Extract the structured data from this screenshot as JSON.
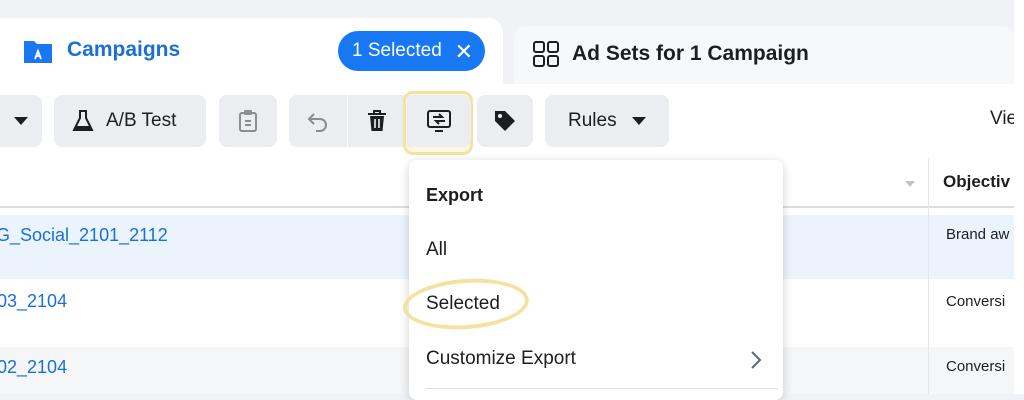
{
  "tabs": {
    "campaigns_label": "Campaigns",
    "selected_label": "1 Selected",
    "selected_close": "✕",
    "adsets_label": "Ad Sets for 1 Campaign"
  },
  "toolbar": {
    "ab_test_label": "A/B Test",
    "rules_label": "Rules",
    "view_partial": "Vie"
  },
  "table": {
    "objective_header": "Objectiv",
    "rows": [
      {
        "name": "G_Social_2101_2112",
        "objective": "Brand aw"
      },
      {
        "name": "03_2104",
        "objective": "Conversi"
      },
      {
        "name": "02_2104",
        "objective": "Conversi"
      }
    ]
  },
  "export_menu": {
    "header": "Export",
    "items": [
      "All",
      "Selected",
      "Customize Export"
    ]
  },
  "colors": {
    "accent": "#1877f2",
    "link": "#1a6fd8",
    "highlight": "#f3e3a0"
  },
  "icons": [
    "campaign-folder-icon",
    "close-icon",
    "adsets-grid-icon",
    "chevron-down-icon",
    "flask-icon",
    "clipboard-icon",
    "undo-icon",
    "trash-icon",
    "export-icon",
    "tag-icon",
    "caret-down-icon",
    "chevron-right-icon",
    "sort-caret-icon"
  ]
}
